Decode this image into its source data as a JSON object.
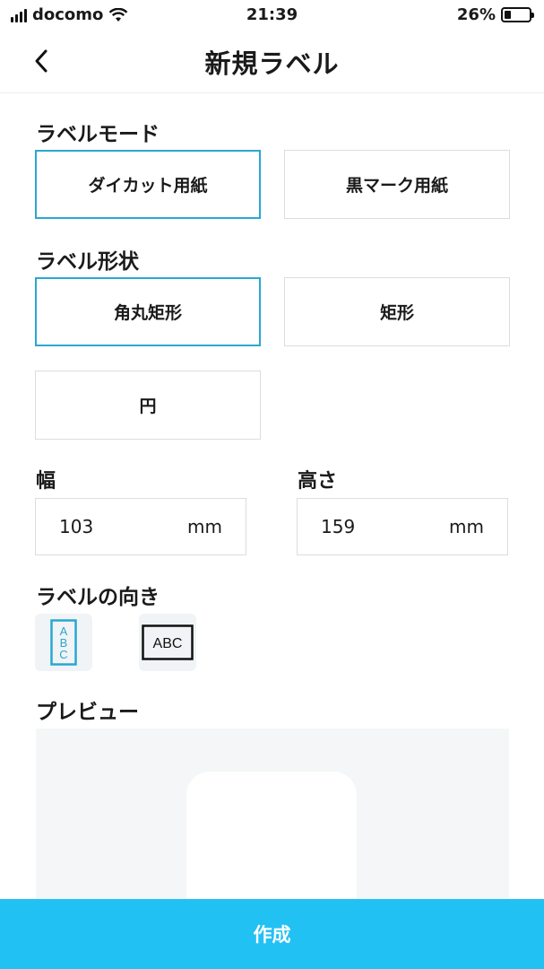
{
  "status_bar": {
    "carrier": "docomo",
    "time": "21:39",
    "battery_percent": "26%",
    "battery_level": 0.26
  },
  "nav": {
    "title": "新規ラベル",
    "back_icon": "chevron-left-icon"
  },
  "label_mode": {
    "heading": "ラベルモード",
    "options": [
      {
        "label": "ダイカット用紙",
        "selected": true
      },
      {
        "label": "黒マーク用紙",
        "selected": false
      }
    ]
  },
  "label_shape": {
    "heading": "ラベル形状",
    "options": [
      {
        "label": "角丸矩形",
        "selected": true
      },
      {
        "label": "矩形",
        "selected": false
      },
      {
        "label": "円",
        "selected": false
      }
    ]
  },
  "dimensions": {
    "width": {
      "label": "幅",
      "value": "103",
      "unit": "mm"
    },
    "height": {
      "label": "高さ",
      "value": "159",
      "unit": "mm"
    }
  },
  "orientation": {
    "heading": "ラベルの向き",
    "vertical_text": "ABC",
    "horizontal_text": "ABC",
    "selected": "vertical"
  },
  "preview": {
    "heading": "プレビュー"
  },
  "create_button": {
    "label": "作成"
  },
  "colors": {
    "accent": "#29a7d3",
    "button": "#22c1f4",
    "border": "#dddddd",
    "preview_bg": "#f4f6f7"
  }
}
